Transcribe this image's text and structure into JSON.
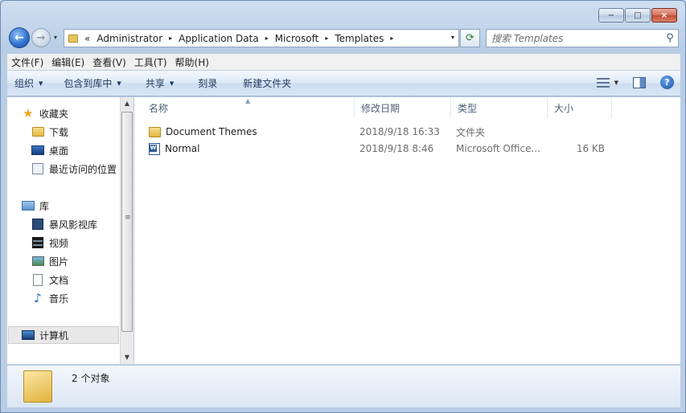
{
  "window": {
    "caption_buttons": {
      "minimize": "−",
      "maximize": "□",
      "close": "×"
    }
  },
  "navbar": {
    "back_glyph": "←",
    "forward_glyph": "→",
    "history_glyph": "▾",
    "address_overflow": "«",
    "breadcrumbs": [
      "Administrator",
      "Application Data",
      "Microsoft",
      "Templates"
    ],
    "crumb_separator": "▸",
    "address_dropdown_glyph": "▾",
    "refresh_glyph": "⟳",
    "search_placeholder": "搜索 Templates",
    "search_glyph": "⚲"
  },
  "menubar": {
    "items": [
      "文件(F)",
      "编辑(E)",
      "查看(V)",
      "工具(T)",
      "帮助(H)"
    ]
  },
  "commandbar": {
    "organize": "组织",
    "include_in_library": "包含到库中",
    "share": "共享",
    "burn": "刻录",
    "new_folder": "新建文件夹",
    "dropdown_glyph": "▼",
    "help_glyph": "?"
  },
  "nav_pane": {
    "favorites": {
      "label": "收藏夹",
      "icon": "star-icon"
    },
    "favorite_items": [
      {
        "label": "下载",
        "icon": "download-folder-icon"
      },
      {
        "label": "桌面",
        "icon": "desktop-icon"
      },
      {
        "label": "最近访问的位置",
        "icon": "recent-places-icon"
      }
    ],
    "libraries": {
      "label": "库",
      "icon": "libraries-icon"
    },
    "library_items": [
      {
        "label": "暴风影视库",
        "icon": "media-library-icon"
      },
      {
        "label": "视频",
        "icon": "videos-icon"
      },
      {
        "label": "图片",
        "icon": "pictures-icon"
      },
      {
        "label": "文档",
        "icon": "documents-icon"
      },
      {
        "label": "音乐",
        "icon": "music-icon"
      }
    ],
    "computer": {
      "label": "计算机",
      "icon": "computer-icon"
    },
    "scroll_up_glyph": "▲",
    "scroll_down_glyph": "▼",
    "scroll_grip_glyph": "≡"
  },
  "file_list": {
    "columns": [
      "名称",
      "修改日期",
      "类型",
      "大小"
    ],
    "sort_glyph": "▲",
    "rows": [
      {
        "name": "Document Themes",
        "date": "2018/9/18 16:33",
        "type": "文件夹",
        "size": "",
        "icon": "folder-icon"
      },
      {
        "name": "Normal",
        "date": "2018/9/18 8:46",
        "type": "Microsoft Office...",
        "size": "16 KB",
        "icon": "word-template-icon"
      }
    ]
  },
  "statusbar": {
    "item_count": "2 个对象"
  }
}
